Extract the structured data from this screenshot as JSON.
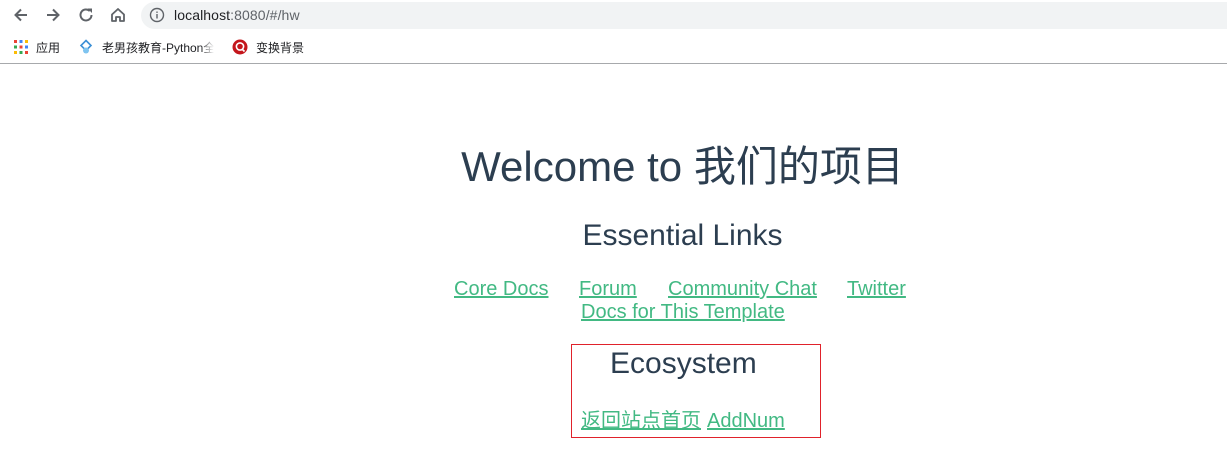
{
  "browser": {
    "url_host": "localhost",
    "url_rest": ":8080/#/hw",
    "bookmarks": [
      {
        "label": "应用",
        "icon": "apps-grid-icon"
      },
      {
        "label": "老男孩教育-Python全",
        "icon": "site-favicon-icon"
      },
      {
        "label": "变换背景",
        "icon": "red-circle-icon"
      }
    ]
  },
  "page": {
    "title": "Welcome to 我们的项目",
    "essential_heading": "Essential Links",
    "essential_links": [
      "Core Docs",
      "Forum",
      "Community Chat",
      "Twitter",
      "Docs for This Template"
    ],
    "ecosystem_heading": "Ecosystem",
    "ecosystem_links": [
      "返回站点首页",
      "AddNum"
    ]
  },
  "colors": {
    "link": "#42b983",
    "text": "#2c3e50",
    "box_border": "#e0222b"
  }
}
